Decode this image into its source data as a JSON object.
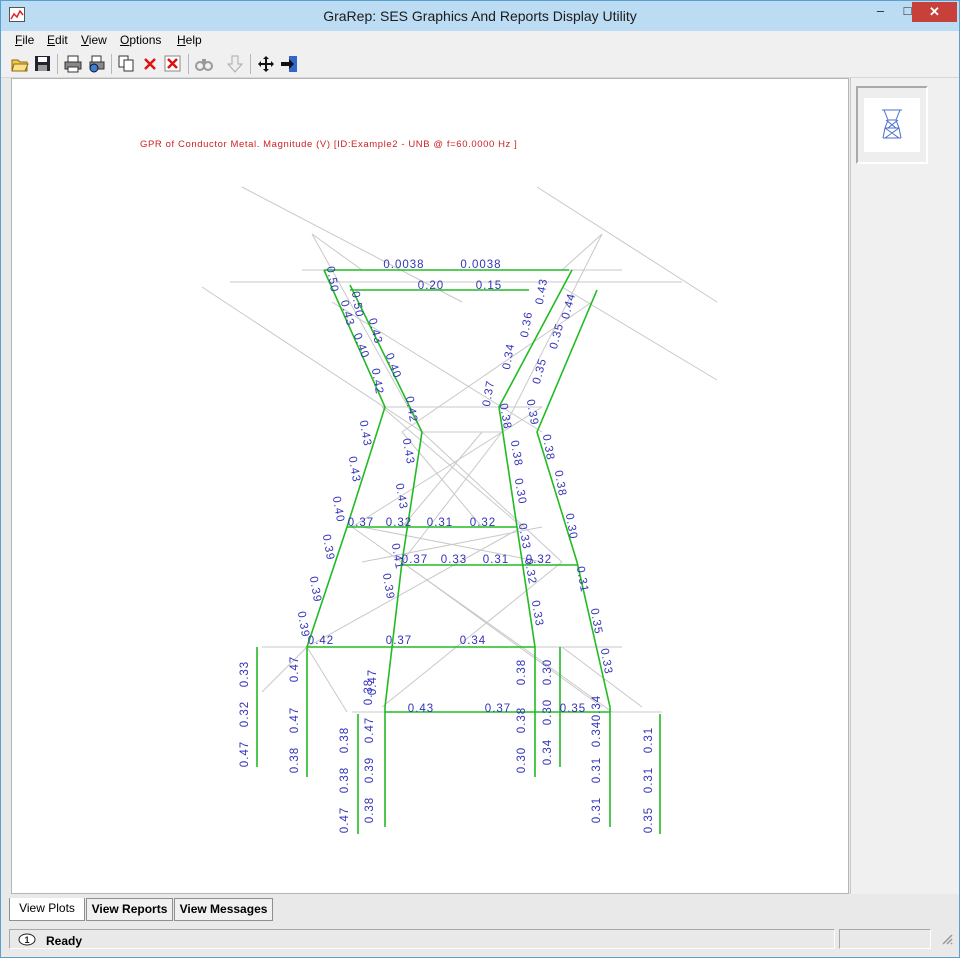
{
  "window": {
    "title": "GraRep: SES Graphics And Reports Display Utility",
    "controls": {
      "minimize": "–",
      "maximize": "□",
      "close": "✕"
    }
  },
  "menu": [
    {
      "label": "File",
      "underline": "F",
      "rest": "ile"
    },
    {
      "label": "Edit",
      "underline": "E",
      "rest": "dit"
    },
    {
      "label": "View",
      "underline": "V",
      "rest": "iew"
    },
    {
      "label": "Options",
      "underline": "O",
      "rest": "ptions"
    },
    {
      "label": "Help",
      "underline": "H",
      "rest": "elp"
    }
  ],
  "toolbar": {
    "buttons": [
      {
        "name": "open-icon"
      },
      {
        "name": "save-icon"
      },
      {
        "name": "print-icon"
      },
      {
        "name": "print-preview-icon"
      },
      {
        "name": "copy-icon"
      },
      {
        "name": "delete-icon"
      },
      {
        "name": "delete-all-icon"
      },
      {
        "name": "find-icon",
        "disabled": true
      },
      {
        "name": "down-arrow-icon",
        "disabled": true
      },
      {
        "name": "move-icon"
      },
      {
        "name": "export-icon"
      }
    ]
  },
  "plot": {
    "title": "GPR of Conductor Metal. Magnitude (V) [ID:Example2 - UNB  @ f=60.0000 Hz ]",
    "title_color": "#cc2222",
    "label_color": "#3333bb",
    "conductor_color": "#22bb22",
    "structure_color": "#c8c8c8",
    "labels": [
      "0.0038",
      "0.0038",
      "0.20",
      "0.15",
      "0.50",
      "0.50",
      "0.43",
      "0.43",
      "0.40",
      "0.40",
      "0.42",
      "0.42",
      "0.43",
      "0.43",
      "0.43",
      "0.40",
      "0.43",
      "0.37",
      "0.32",
      "0.31",
      "0.32",
      "0.41",
      "0.37",
      "0.33",
      "0.31",
      "0.32",
      "0.39",
      "0.39",
      "0.39",
      "0.39",
      "0.42",
      "0.37",
      "0.34",
      "0.43",
      "0.37",
      "0.35",
      "0.43",
      "0.36",
      "0.34",
      "0.37",
      "0.44",
      "0.35",
      "0.35",
      "0.38",
      "0.39",
      "0.38",
      "0.38",
      "0.38",
      "0.30",
      "0.30",
      "0.33",
      "0.32",
      "0.31",
      "0.33",
      "0.35",
      "0.33",
      "0.33",
      "0.32",
      "0.47",
      "0.47",
      "0.47",
      "0.38",
      "0.38",
      "0.38",
      "0.38",
      "0.47",
      "0.47",
      "0.47",
      "0.39",
      "0.38",
      "0.38",
      "0.38",
      "0.30",
      "0.30",
      "0.30",
      "0.34",
      "0.34",
      "0.34",
      "0.31",
      "0.31",
      "0.31",
      "0.31",
      "0.35",
      "0.35",
      "0.35"
    ]
  },
  "tabs": [
    "View Plots",
    "View Reports",
    "View Messages"
  ],
  "status": {
    "text": "Ready"
  }
}
